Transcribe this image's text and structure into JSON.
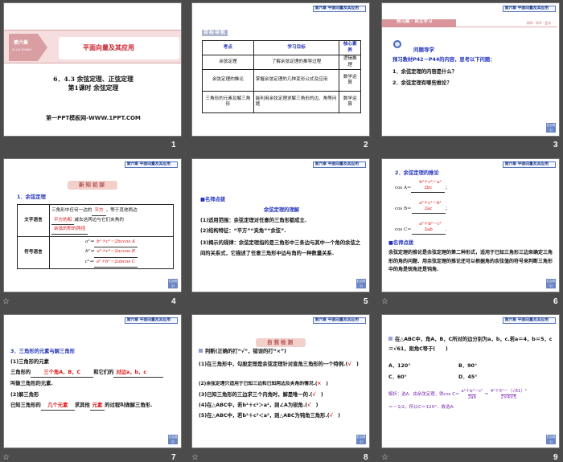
{
  "chapter_tag": "第六章  平面向量及其应用",
  "nav_label": "栏目导引",
  "slides": [
    {
      "number": "1",
      "chapter": "第六章",
      "chapter_pinyin": "DI LIU ZHANG",
      "title": "平面向量及其应用",
      "line1": "6．4.3  余弦定理、正弦定理",
      "line2": "第1课时  余弦定理",
      "footer": "第一PPT模板网-WWW.1PPT.COM"
    },
    {
      "number": "2",
      "badge": "目标导航",
      "headers": [
        "考点",
        "学习目标",
        "核心素养"
      ],
      "rows": [
        [
          "余弦定理",
          "了解余弦定理的推导过程",
          "逻辑推理"
        ],
        [
          "余弦定理的推论",
          "掌握余弦定理的几种变形公式及应用",
          "数学运算"
        ],
        [
          "三角形的元素及解三角形",
          "能利用余弦定理求解三角形的边、角等问题",
          "数学运算"
        ]
      ]
    },
    {
      "number": "3",
      "banner": "预习案 · 自主学习",
      "banner_right": "新知 · 导学 · 尝试",
      "heading": "问题导学",
      "intro": "预习教材P42－P44的内容，思考以下问题：",
      "q1": "1．余弦定理的内容是什么？",
      "q2": "2．余弦定理有哪些推论？"
    },
    {
      "number": "4",
      "badge": "新知初探",
      "heading": "1．余弦定理",
      "row1_label": "文字语言",
      "text_a": "三角形中任何一边的",
      "blank1": "平方",
      "text_b": "，等于其他两边",
      "blank2": "平方的和",
      "text_c": "减去这两边与它们夹角的",
      "blank3": "余弦的积的两倍",
      "row2_label": "符号语言",
      "f1_l": "a²＝",
      "f1": "b²＋c²－2bccos A",
      "f2_l": "b²＝",
      "f2": "a²＋c²－2accos B",
      "f3_l": "c²＝",
      "f3": "a²＋b²－2abcos C"
    },
    {
      "number": "5",
      "heading": "■名师点拨",
      "subheading": "余弦定理的理解",
      "p1": "(1)适用范围：余弦定理对任意的三角形都成立.",
      "p2": "(2)结构特征：“平方”“夹角”“余弦”.",
      "p3": "(3)揭示的规律：余弦定理指的是三角形中三条边与其中一个角的余弦之间的关系式，它描述了任意三角形中边与角的一种数量关系."
    },
    {
      "number": "6",
      "heading": "2．余弦定理的推论",
      "cosA": "cos A＝",
      "cosA_num": "b²＋c²－a²",
      "cosA_den": "2bc",
      "cosB": "cos B＝",
      "cosB_num": "a²＋c²－b²",
      "cosB_den": "2ac",
      "cosC": "cos C＝",
      "cosC_num": "a²＋b²－c²",
      "cosC_den": "2ab",
      "heading2": "■名师点拨",
      "p": "余弦定理的推论是余弦定理的第二种形式，适用于已知三角形三边来确定三角形的角的问题．用余弦定理的推论还可以根据角的余弦值的符号来判断三角形中的角是锐角还是钝角."
    },
    {
      "number": "7",
      "heading": "3．三角形的元素与解三角形",
      "s1": "(1)三角形的元素",
      "t1": "三角形的",
      "b1": "三个角A，B，C",
      "t2": "和它们的",
      "b2": "对边a，b，c",
      "t3": "叫做三角形的元素.",
      "s2": "(2)解三角形",
      "t4": "已知三角形的",
      "b3": "几个元素",
      "t5": "求其他",
      "b4": "元素",
      "t6": "的过程叫做解三角形."
    },
    {
      "number": "8",
      "badge": "自我检测",
      "intro": "判断(正确的打“√”，错误的打“×”)",
      "items": [
        {
          "text": "(1)在三角形中，勾股定理是余弦定理针对直角三角形的一个特例.",
          "ans": "√"
        },
        {
          "text": "(2)余弦定理只适用于已知三边和已知两边及夹角的情况.",
          "ans": "×"
        },
        {
          "text": "(3)已知三角形的三边求三个内角时，解是唯一的.",
          "ans": "√"
        },
        {
          "text": "(4)在△ABC中，若b²＋c²＞a²，则∠A为锐角.",
          "ans": "√"
        },
        {
          "text": "(5)在△ABC中，若b²＋c²＜a²，则△ABC为钝角三角形.",
          "ans": "√"
        }
      ]
    },
    {
      "number": "9",
      "question": "在△ABC中，角A，B，C所对的边分别为a，b，c.若a＝4，b＝5，c＝√61，则角C等于(　　)",
      "options": [
        "A．120°",
        "B．90°",
        "C．60°",
        "D．45°"
      ],
      "solution_a": "解析：选A．由余弦定理，得cos C＝",
      "frac1_num": "a²＋b²－c²",
      "frac1_den": "2ab",
      "frac2_num": "4²＋5²－（√61）²",
      "frac2_den": "2×4×5",
      "solution_b": "＝－1/2，所以C＝120°．故选A."
    }
  ]
}
